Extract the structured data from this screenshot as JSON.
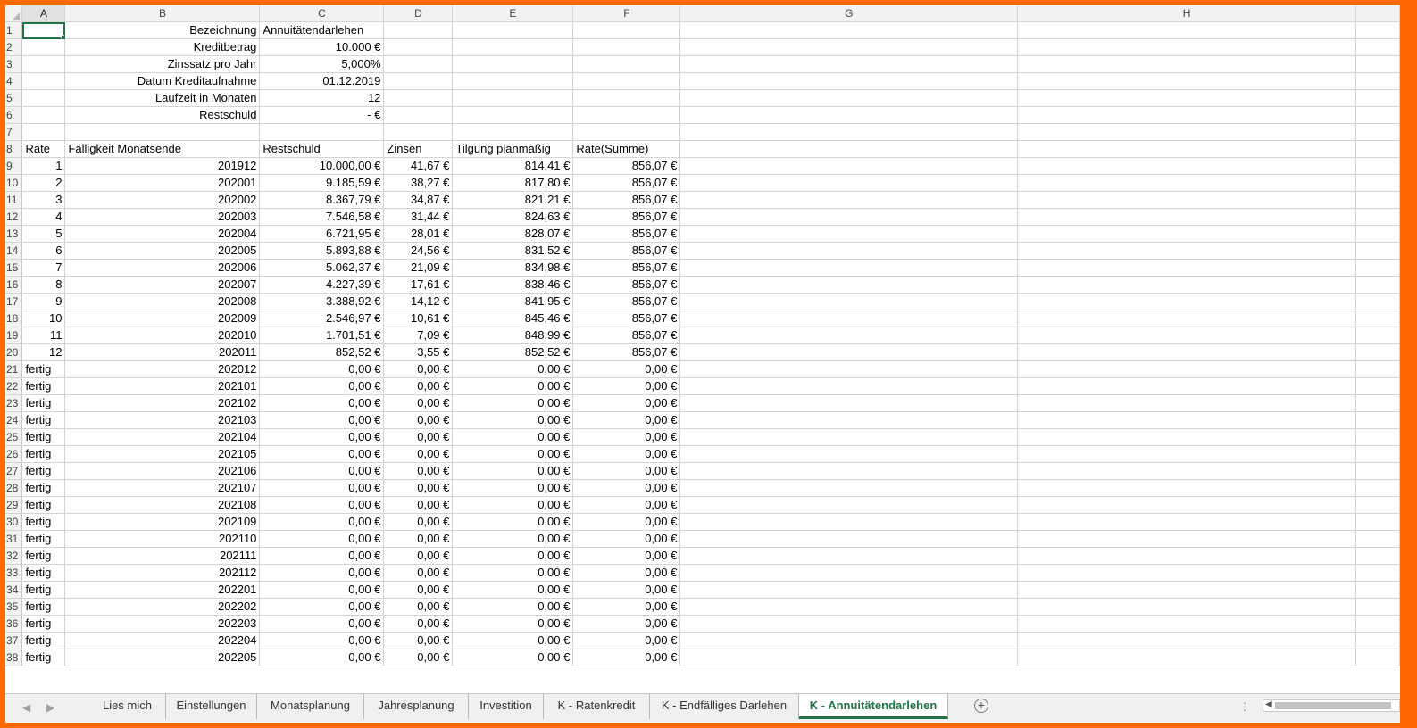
{
  "columns": [
    "A",
    "B",
    "C",
    "D",
    "E",
    "F",
    "G",
    "H"
  ],
  "summary": [
    {
      "row": "1",
      "label": "Bezeichnung",
      "value": "Annuitätendarlehen",
      "align": "l"
    },
    {
      "row": "2",
      "label": "Kreditbetrag",
      "value": "10.000 €",
      "align": "r"
    },
    {
      "row": "3",
      "label": "Zinssatz pro Jahr",
      "value": "5,000%",
      "align": "r"
    },
    {
      "row": "4",
      "label": "Datum Kreditaufnahme",
      "value": "01.12.2019",
      "align": "r"
    },
    {
      "row": "5",
      "label": "Laufzeit in Monaten",
      "value": "12",
      "align": "r"
    },
    {
      "row": "6",
      "label": "Restschuld",
      "value": "-   €",
      "align": "r"
    },
    {
      "row": "7",
      "label": "",
      "value": "",
      "align": "r"
    }
  ],
  "table_header": {
    "row": "8",
    "cols": [
      "Rate",
      "Fälligkeit Monatsende",
      "Restschuld",
      "Zinsen",
      "Tilgung planmäßig",
      "Rate(Summe)"
    ]
  },
  "rows": [
    {
      "row": "9",
      "cells": [
        "1",
        "201912",
        "10.000,00 €",
        "41,67 €",
        "814,41 €",
        "856,07 €"
      ]
    },
    {
      "row": "10",
      "cells": [
        "2",
        "202001",
        "9.185,59 €",
        "38,27 €",
        "817,80 €",
        "856,07 €"
      ]
    },
    {
      "row": "11",
      "cells": [
        "3",
        "202002",
        "8.367,79 €",
        "34,87 €",
        "821,21 €",
        "856,07 €"
      ]
    },
    {
      "row": "12",
      "cells": [
        "4",
        "202003",
        "7.546,58 €",
        "31,44 €",
        "824,63 €",
        "856,07 €"
      ]
    },
    {
      "row": "13",
      "cells": [
        "5",
        "202004",
        "6.721,95 €",
        "28,01 €",
        "828,07 €",
        "856,07 €"
      ]
    },
    {
      "row": "14",
      "cells": [
        "6",
        "202005",
        "5.893,88 €",
        "24,56 €",
        "831,52 €",
        "856,07 €"
      ]
    },
    {
      "row": "15",
      "cells": [
        "7",
        "202006",
        "5.062,37 €",
        "21,09 €",
        "834,98 €",
        "856,07 €"
      ]
    },
    {
      "row": "16",
      "cells": [
        "8",
        "202007",
        "4.227,39 €",
        "17,61 €",
        "838,46 €",
        "856,07 €"
      ]
    },
    {
      "row": "17",
      "cells": [
        "9",
        "202008",
        "3.388,92 €",
        "14,12 €",
        "841,95 €",
        "856,07 €"
      ]
    },
    {
      "row": "18",
      "cells": [
        "10",
        "202009",
        "2.546,97 €",
        "10,61 €",
        "845,46 €",
        "856,07 €"
      ]
    },
    {
      "row": "19",
      "cells": [
        "11",
        "202010",
        "1.701,51 €",
        "7,09 €",
        "848,99 €",
        "856,07 €"
      ]
    },
    {
      "row": "20",
      "cells": [
        "12",
        "202011",
        "852,52 €",
        "3,55 €",
        "852,52 €",
        "856,07 €"
      ]
    },
    {
      "row": "21",
      "cells": [
        "fertig",
        "202012",
        "0,00 €",
        "0,00 €",
        "0,00 €",
        "0,00 €"
      ]
    },
    {
      "row": "22",
      "cells": [
        "fertig",
        "202101",
        "0,00 €",
        "0,00 €",
        "0,00 €",
        "0,00 €"
      ]
    },
    {
      "row": "23",
      "cells": [
        "fertig",
        "202102",
        "0,00 €",
        "0,00 €",
        "0,00 €",
        "0,00 €"
      ]
    },
    {
      "row": "24",
      "cells": [
        "fertig",
        "202103",
        "0,00 €",
        "0,00 €",
        "0,00 €",
        "0,00 €"
      ]
    },
    {
      "row": "25",
      "cells": [
        "fertig",
        "202104",
        "0,00 €",
        "0,00 €",
        "0,00 €",
        "0,00 €"
      ]
    },
    {
      "row": "26",
      "cells": [
        "fertig",
        "202105",
        "0,00 €",
        "0,00 €",
        "0,00 €",
        "0,00 €"
      ]
    },
    {
      "row": "27",
      "cells": [
        "fertig",
        "202106",
        "0,00 €",
        "0,00 €",
        "0,00 €",
        "0,00 €"
      ]
    },
    {
      "row": "28",
      "cells": [
        "fertig",
        "202107",
        "0,00 €",
        "0,00 €",
        "0,00 €",
        "0,00 €"
      ]
    },
    {
      "row": "29",
      "cells": [
        "fertig",
        "202108",
        "0,00 €",
        "0,00 €",
        "0,00 €",
        "0,00 €"
      ]
    },
    {
      "row": "30",
      "cells": [
        "fertig",
        "202109",
        "0,00 €",
        "0,00 €",
        "0,00 €",
        "0,00 €"
      ]
    },
    {
      "row": "31",
      "cells": [
        "fertig",
        "202110",
        "0,00 €",
        "0,00 €",
        "0,00 €",
        "0,00 €"
      ]
    },
    {
      "row": "32",
      "cells": [
        "fertig",
        "202111",
        "0,00 €",
        "0,00 €",
        "0,00 €",
        "0,00 €"
      ]
    },
    {
      "row": "33",
      "cells": [
        "fertig",
        "202112",
        "0,00 €",
        "0,00 €",
        "0,00 €",
        "0,00 €"
      ]
    },
    {
      "row": "34",
      "cells": [
        "fertig",
        "202201",
        "0,00 €",
        "0,00 €",
        "0,00 €",
        "0,00 €"
      ]
    },
    {
      "row": "35",
      "cells": [
        "fertig",
        "202202",
        "0,00 €",
        "0,00 €",
        "0,00 €",
        "0,00 €"
      ]
    },
    {
      "row": "36",
      "cells": [
        "fertig",
        "202203",
        "0,00 €",
        "0,00 €",
        "0,00 €",
        "0,00 €"
      ]
    },
    {
      "row": "37",
      "cells": [
        "fertig",
        "202204",
        "0,00 €",
        "0,00 €",
        "0,00 €",
        "0,00 €"
      ]
    },
    {
      "row": "38",
      "cells": [
        "fertig",
        "202205",
        "0,00 €",
        "0,00 €",
        "0,00 €",
        "0,00 €"
      ]
    }
  ],
  "sheet_tabs": [
    "Lies mich",
    "Einstellungen",
    "Monatsplanung",
    "Jahresplanung",
    "Investition",
    "K - Ratenkredit",
    "K - Endfälliges Darlehen",
    "K - Annuitätendarlehen"
  ],
  "active_tab_index": 7,
  "tab_nav": {
    "prev": "◀",
    "next": "▶",
    "add": "+",
    "more": "⋮",
    "scroll_left": "◀"
  },
  "colors": {
    "accent": "#217346",
    "border": "#ff6a00"
  }
}
